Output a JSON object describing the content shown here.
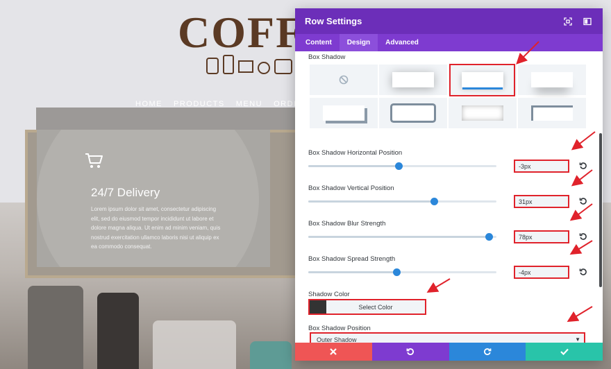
{
  "site": {
    "logo_text": "COFF",
    "nav": [
      "HOME",
      "PRODUCTS",
      "MENU",
      "ORDER"
    ],
    "card": {
      "icon": "cart-icon",
      "title": "24/7 Delivery",
      "text": "Lorem ipsum dolor sit amet, consectetur adipiscing elit, sed do eiusmod tempor incididunt ut labore et dolore magna aliqua. Ut enim ad minim veniam, quis nostrud exercitation ullamco laboris nisi ut aliquip ex ea commodo consequat."
    }
  },
  "modal": {
    "title": "Row Settings",
    "header_icons": [
      "fullscreen-icon",
      "sidebar-toggle-icon"
    ],
    "tabs": [
      {
        "label": "Content",
        "active": false
      },
      {
        "label": "Design",
        "active": true
      },
      {
        "label": "Advanced",
        "active": false
      }
    ],
    "box_shadow_label": "Box Shadow",
    "presets": [
      "none",
      "preset-1",
      "preset-2",
      "preset-3",
      "preset-4",
      "preset-5",
      "preset-6",
      "preset-7"
    ],
    "selected_preset": "preset-2",
    "sliders": [
      {
        "label": "Box Shadow Horizontal Position",
        "value": "-3px",
        "level": 0.48
      },
      {
        "label": "Box Shadow Vertical Position",
        "value": "31px",
        "level": 0.67
      },
      {
        "label": "Box Shadow Blur Strength",
        "value": "78px",
        "level": 0.96
      },
      {
        "label": "Box Shadow Spread Strength",
        "value": "-4px",
        "level": 0.47
      }
    ],
    "shadow_color": {
      "label": "Shadow Color",
      "button_label": "Select Color",
      "swatch": "#333333"
    },
    "shadow_position": {
      "label": "Box Shadow Position",
      "value": "Outer Shadow"
    },
    "footer": [
      "close-icon",
      "undo-icon",
      "redo-icon",
      "check-icon"
    ]
  },
  "colors": {
    "header": "#6c2eb9",
    "tabs": "#7e3bd0",
    "accent_blue": "#2b87da",
    "annotation_red": "#e0222b",
    "cancel": "#ef5555",
    "save": "#29c4a9"
  }
}
